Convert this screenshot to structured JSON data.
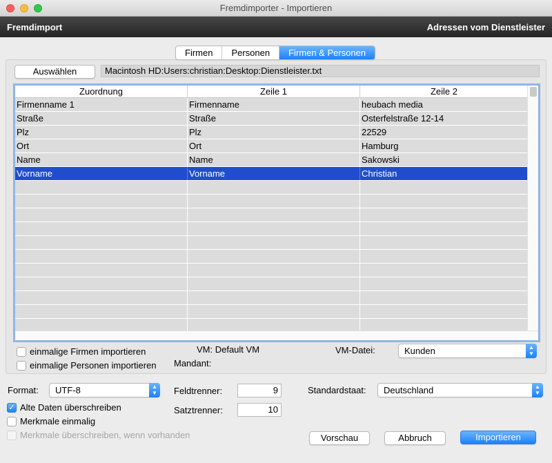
{
  "window": {
    "title": "Fremdimporter - Importieren"
  },
  "header": {
    "left": "Fremdimport",
    "right": "Adressen vom Dienstleister"
  },
  "tabs": [
    {
      "label": "Firmen",
      "active": false
    },
    {
      "label": "Personen",
      "active": false
    },
    {
      "label": "Firmen & Personen",
      "active": true
    }
  ],
  "file": {
    "choose_label": "Auswählen",
    "path": "Macintosh HD:Users:christian:Desktop:Dienstleister.txt"
  },
  "table": {
    "columns": [
      "Zuordnung",
      "Zeile 1",
      "Zeile 2"
    ],
    "rows": [
      [
        "Firmenname 1",
        "Firmenname",
        "heubach media"
      ],
      [
        "Straße",
        "Straße",
        "Osterfelstraße 12-14"
      ],
      [
        "Plz",
        "Plz",
        "22529"
      ],
      [
        "Ort",
        "Ort",
        "Hamburg"
      ],
      [
        "Name",
        "Name",
        "Sakowski"
      ],
      [
        "Vorname",
        "Vorname",
        "Christian"
      ]
    ],
    "selected_row": 5
  },
  "options": {
    "unique_companies": {
      "label": "einmalige Firmen importieren",
      "checked": false
    },
    "unique_persons": {
      "label": "einmalige Personen importieren",
      "checked": false
    },
    "vm_text": "VM: Default VM",
    "mandant_label": "Mandant:",
    "vm_file_label": "VM-Datei:",
    "vm_file_value": "Kunden"
  },
  "settings": {
    "format_label": "Format:",
    "format_value": "UTF-8",
    "field_sep_label": "Feldtrenner:",
    "field_sep_value": "9",
    "record_sep_label": "Satztrenner:",
    "record_sep_value": "10",
    "country_label": "Standardstaat:",
    "country_value": "Deutschland",
    "overwrite": {
      "label": "Alte Daten überschreiben",
      "checked": true
    },
    "features_once": {
      "label": "Merkmale einmalig",
      "checked": false
    },
    "features_overwrite": {
      "label": "Merkmale überschreiben, wenn vorhanden",
      "checked": false,
      "disabled": true
    }
  },
  "buttons": {
    "preview": "Vorschau",
    "cancel": "Abbruch",
    "import": "Importieren"
  },
  "colors": {
    "accent": "#1a82fb",
    "selection": "#1f4dcd",
    "header_bg": "#333333"
  }
}
